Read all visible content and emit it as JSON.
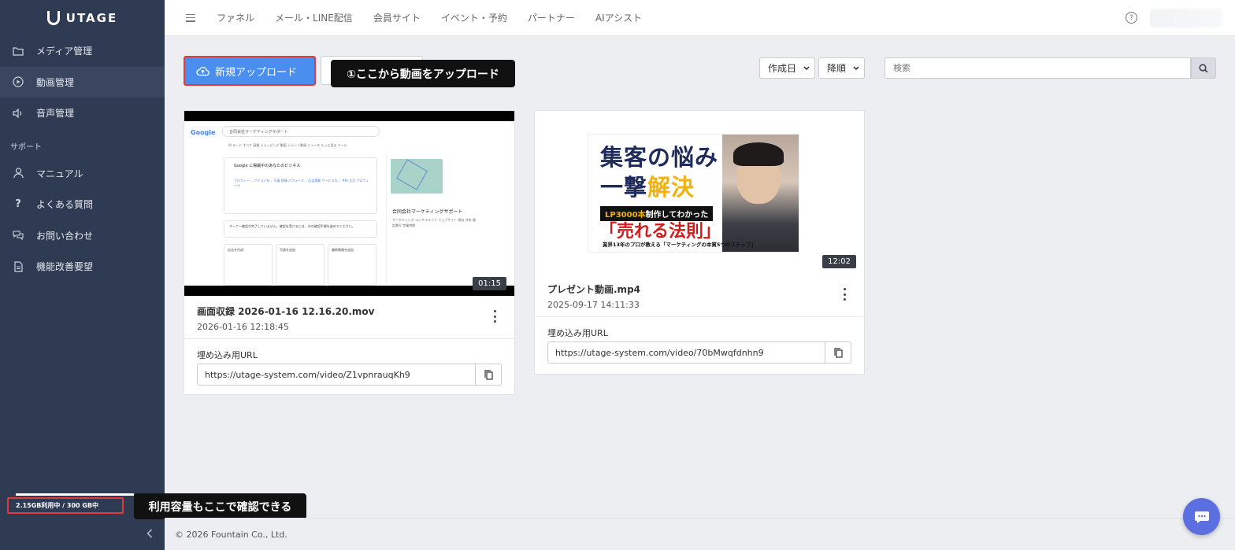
{
  "brand": {
    "name": "UTAGE"
  },
  "sidebar": {
    "items": [
      {
        "label": "メディア管理",
        "icon": "folder-icon"
      },
      {
        "label": "動画管理",
        "icon": "play-circle-icon",
        "active": true
      },
      {
        "label": "音声管理",
        "icon": "speaker-icon"
      }
    ],
    "support_section": "サポート",
    "support_items": [
      {
        "label": "マニュアル",
        "icon": "person-icon"
      },
      {
        "label": "よくある質問",
        "icon": "question-icon"
      },
      {
        "label": "お問い合わせ",
        "icon": "chat-bubbles-icon"
      },
      {
        "label": "機能改善要望",
        "icon": "document-icon"
      }
    ],
    "storage": "2.15GB利用中 / 300 GB中"
  },
  "topbar": {
    "menu": [
      "ファネル",
      "メール・LINE配信",
      "会員サイト",
      "イベント・予約",
      "パートナー",
      "AIアシスト"
    ]
  },
  "toolbar": {
    "upload_label": "新規アップロード",
    "sort_field": "作成日",
    "sort_order": "降順",
    "search_placeholder": "検索"
  },
  "tooltips": {
    "upload": "①ここから動画をアップロード",
    "storage": "利用容量もここで確認できる"
  },
  "videos": [
    {
      "title": "画面収録 2026-01-16 12.16.20.mov",
      "date": "2026-01-16 12:18:45",
      "duration": "01:15",
      "embed_label": "埋め込み用URL",
      "embed_url": "https://utage-system.com/video/Z1vpnrauqKh9",
      "thumb": {
        "logo": "Google",
        "search": "合同会社マーケティングサポート",
        "tabs": "AI モード  すべて  画像  ショッピング  動画  ショート動画  ニュース  もっと見る  ツール",
        "panel_title": "Google に掲載中のあなたのビジネス",
        "icons": "プロフィー…  クチコミを…  写真  投稿  パフォーマ…  広告掲載  サービスの…  予約  注文  プロフィール",
        "warning": "オーナー確認が完了していません。確認を受けるには、次の確認手順を進めてください。",
        "cards": [
          "広告を作成",
          "写真を追加",
          "最新情報を追加"
        ],
        "biz_name": "合同会社マーケティングサポート",
        "biz_meta": "マーケティング コンサルタント  ウェブサイト  保存  共有  電話番号  営業時間"
      }
    },
    {
      "title": "プレゼント動画.mp4",
      "date": "2025-09-17 14:11:33",
      "duration": "12:02",
      "embed_label": "埋め込み用URL",
      "embed_url": "https://utage-system.com/video/70bMwqfdnhn9",
      "thumb": {
        "head1": "集客の悩み",
        "head2a": "一撃",
        "head2b": "解決",
        "sub_a": "LP3000本",
        "sub_b": "制作してわかった",
        "law": "「売れる法則」",
        "foot": "業界13年のプロが教える「マーケティングの本質5つのステップ」"
      }
    }
  ],
  "footer": {
    "copyright": "© 2026 Fountain Co., Ltd."
  },
  "colors": {
    "sidebar": "#2f3b52",
    "primary": "#4a8ff0",
    "highlight": "#e23a3a",
    "chat": "#5b6fe0"
  }
}
